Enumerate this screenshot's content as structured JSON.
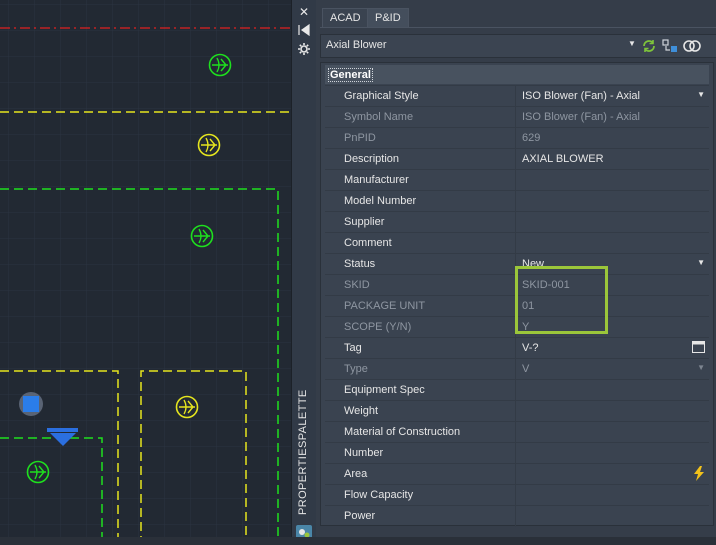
{
  "canvas": {
    "symbols": [
      {
        "icon": "axial-blower-symbol-icon",
        "color": "#1ee01e"
      },
      {
        "icon": "axial-blower-symbol-icon",
        "color": "#e6e61e"
      },
      {
        "icon": "axial-blower-symbol-icon",
        "color": "#1ee01e"
      },
      {
        "icon": "axial-blower-symbol-icon",
        "color": "#e6e61e"
      },
      {
        "icon": "axial-blower-symbol-icon",
        "color": "#1ee01e"
      }
    ],
    "colors": {
      "red_line": "#e02020",
      "yellow_dash": "#e6e61e",
      "green_dash": "#1ee01e",
      "grip": "#2b7de9"
    }
  },
  "palette_strip": {
    "title": "PROPERTIESPALETTE",
    "icons": [
      "close-icon",
      "auto-hide-icon",
      "settings-icon",
      "palette-icon"
    ]
  },
  "tabs": [
    {
      "label": "ACAD",
      "active": false
    },
    {
      "label": "P&ID",
      "active": true
    }
  ],
  "selector": {
    "value": "Axial Blower",
    "icons": [
      "refresh-icon",
      "quick-select-icon",
      "toggle-pickadd-icon"
    ]
  },
  "properties": {
    "category": "General",
    "rows": [
      {
        "name": "Graphical Style",
        "value": "ISO Blower (Fan) - Axial",
        "readonly": false,
        "control": "dropdown"
      },
      {
        "name": "Symbol Name",
        "value": "ISO Blower (Fan) - Axial",
        "readonly": true,
        "control": ""
      },
      {
        "name": "PnPID",
        "value": "629",
        "readonly": true,
        "control": ""
      },
      {
        "name": "Description",
        "value": "AXIAL BLOWER",
        "readonly": false,
        "control": ""
      },
      {
        "name": "Manufacturer",
        "value": "",
        "readonly": false,
        "control": ""
      },
      {
        "name": "Model Number",
        "value": "",
        "readonly": false,
        "control": ""
      },
      {
        "name": "Supplier",
        "value": "",
        "readonly": false,
        "control": ""
      },
      {
        "name": "Comment",
        "value": "",
        "readonly": false,
        "control": ""
      },
      {
        "name": "Status",
        "value": "New",
        "readonly": false,
        "control": "dropdown"
      },
      {
        "name": "SKID",
        "value": "SKID-001",
        "readonly": true,
        "control": ""
      },
      {
        "name": "PACKAGE UNIT",
        "value": "01",
        "readonly": true,
        "control": ""
      },
      {
        "name": "SCOPE (Y/N)",
        "value": "Y",
        "readonly": true,
        "control": ""
      },
      {
        "name": "Tag",
        "value": "V-?",
        "readonly": false,
        "control": "tag-editor"
      },
      {
        "name": "Type",
        "value": "V",
        "readonly": true,
        "control": "dropdown"
      },
      {
        "name": "Equipment Spec",
        "value": "",
        "readonly": false,
        "control": ""
      },
      {
        "name": "Weight",
        "value": "",
        "readonly": false,
        "control": ""
      },
      {
        "name": "Material of Construction",
        "value": "",
        "readonly": false,
        "control": ""
      },
      {
        "name": "Number",
        "value": "",
        "readonly": false,
        "control": ""
      },
      {
        "name": "Area",
        "value": "",
        "readonly": false,
        "control": "lightning"
      },
      {
        "name": "Flow Capacity",
        "value": "",
        "readonly": false,
        "control": ""
      },
      {
        "name": "Power",
        "value": "",
        "readonly": false,
        "control": ""
      }
    ],
    "highlight_color": "#9bc63a"
  }
}
